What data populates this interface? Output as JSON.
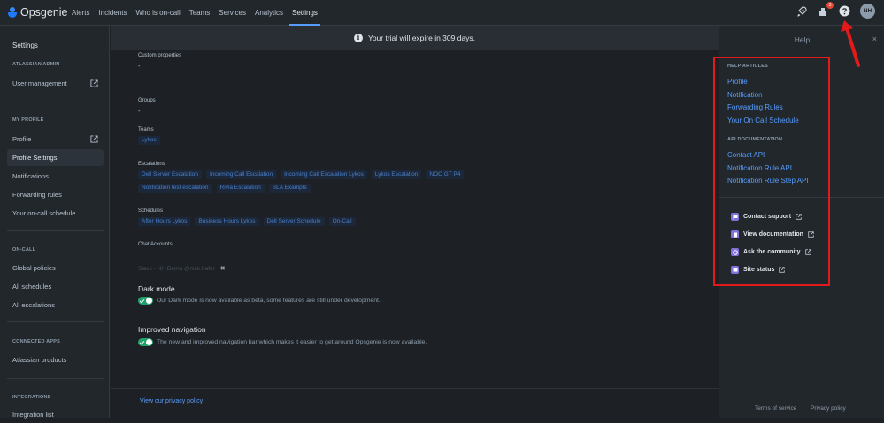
{
  "app": {
    "name": "Opsgenie"
  },
  "nav": {
    "items": [
      "Alerts",
      "Incidents",
      "Who is on-call",
      "Teams",
      "Services",
      "Analytics",
      "Settings"
    ],
    "active": "Settings",
    "notification_count": "3",
    "avatar_initials": "NH"
  },
  "sidebar": {
    "title": "Settings",
    "sections": {
      "admin": "ATLASSIAN ADMIN",
      "profile": "MY PROFILE",
      "oncall": "ON-CALL",
      "connected": "CONNECTED APPS",
      "integrations": "INTEGRATIONS"
    },
    "items": {
      "user_management": "User management",
      "profile": "Profile",
      "profile_settings": "Profile Settings",
      "notifications": "Notifications",
      "forwarding_rules": "Forwarding rules",
      "oncall_schedule": "Your on-call schedule",
      "global_policies": "Global policies",
      "all_schedules": "All schedules",
      "all_escalations": "All escalations",
      "atlassian_products": "Atlassian products",
      "integration_list": "Integration list"
    }
  },
  "banner": {
    "text": "Your trial will expire in 309 days."
  },
  "profile": {
    "custom_properties_label": "Custom properties",
    "custom_properties_value": "-",
    "groups_label": "Groups",
    "groups_value": "-",
    "teams_label": "Teams",
    "teams": [
      "Lykos"
    ],
    "escalations_label": "Escalations",
    "escalations": [
      "Dell Server Escalation",
      "Incoming Call Escalation",
      "Incoming Call Escalation Lykos",
      "Lykos Escalation",
      "NOC GT P4",
      "Notification test escalation",
      "Rivia Escalation",
      "SLA Example"
    ],
    "schedules_label": "Schedules",
    "schedules": [
      "After Hours Lykos",
      "Business Hours Lykos",
      "Dell Server Schedule",
      "On-Call"
    ],
    "chat_label": "Chat Accounts",
    "chat_account": "Slack - NH Demo @nick.hafer"
  },
  "settings": {
    "dark_mode_title": "Dark mode",
    "dark_mode_desc": "Our Dark mode is now available as beta, some features are still under development.",
    "dark_mode_on": true,
    "nav_title": "Improved navigation",
    "nav_desc": "The new and improved navigation bar which makes it easier to get around Opsgenie is now available.",
    "nav_on": true
  },
  "footer": {
    "privacy_link": "View our privacy policy"
  },
  "help": {
    "title": "Help",
    "articles_heading": "HELP ARTICLES",
    "articles": [
      "Profile",
      "Notification",
      "Forwarding Rules",
      "Your On Call Schedule"
    ],
    "api_heading": "API DOCUMENTATION",
    "api": [
      "Contact API",
      "Notification Rule API",
      "Notification Rule Step API"
    ],
    "resources": [
      "Contact support",
      "View documentation",
      "Ask the community",
      "Site status"
    ],
    "terms": "Terms of service",
    "privacy": "Privacy policy"
  },
  "colors": {
    "accent": "#579dff",
    "highlight_box": "#e21a1a",
    "toggle_on": "#22a06b"
  }
}
